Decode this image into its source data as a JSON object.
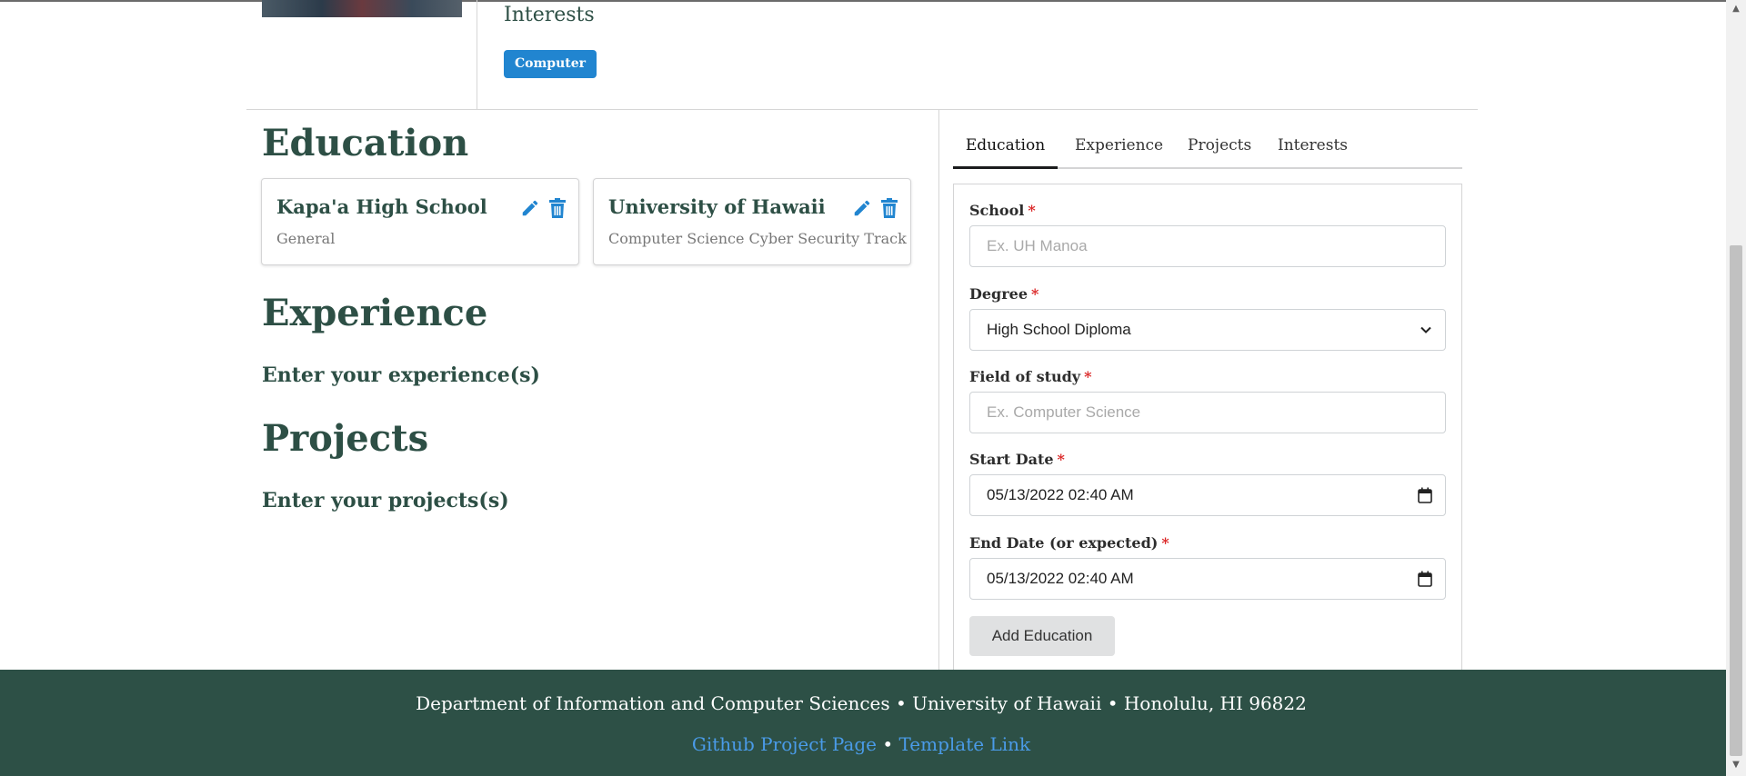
{
  "profile": {
    "interests_title": "Interests",
    "interest_tags": [
      "Computer"
    ]
  },
  "left": {
    "education_title": "Education",
    "education_cards": [
      {
        "school": "Kapa'a High School",
        "field": "General"
      },
      {
        "school": "University of Hawaii",
        "field": "Computer Science Cyber Security Track"
      }
    ],
    "experience_title": "Experience",
    "experience_empty": "Enter your experience(s)",
    "projects_title": "Projects",
    "projects_empty": "Enter your projects(s)"
  },
  "tabs": [
    "Education",
    "Experience",
    "Projects",
    "Interests"
  ],
  "form": {
    "school_label": "School",
    "school_placeholder": "Ex. UH Manoa",
    "degree_label": "Degree",
    "degree_value": "High School Diploma",
    "field_label": "Field of study",
    "field_placeholder": "Ex. Computer Science",
    "start_label": "Start Date",
    "start_value": "05/13/2022 02:40 AM",
    "end_label": "End Date (or expected)",
    "end_value": "05/13/2022 02:40 AM",
    "required_mark": "*",
    "submit_label": "Add Education"
  },
  "footer": {
    "address": "Department of Information and Computer Sciences • University of Hawaii • Honolulu, HI 96822",
    "link1": "Github Project Page",
    "separator": "•",
    "link2": "Template Link"
  },
  "colors": {
    "accent": "#2185d0",
    "brand_green": "#2d5046",
    "required": "#db2828",
    "link": "#4a9be8"
  }
}
